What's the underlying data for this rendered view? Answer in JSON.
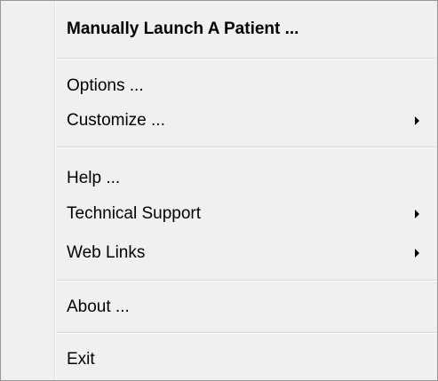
{
  "menu": {
    "manual_launch": {
      "label": "Manually Launch A Patient ..."
    },
    "options": {
      "label": "Options ..."
    },
    "customize": {
      "label": "Customize ..."
    },
    "help": {
      "label": "Help ..."
    },
    "technical_support": {
      "label": "Technical Support"
    },
    "web_links": {
      "label": "Web Links"
    },
    "about": {
      "label": "About ..."
    },
    "exit": {
      "label": "Exit"
    }
  },
  "colors": {
    "menu_background": "#f0f0f0",
    "border": "#979797",
    "separator": "#d7d7d7",
    "text": "#000000"
  },
  "icons": {
    "submenu_arrow": "submenu-arrow-icon"
  }
}
